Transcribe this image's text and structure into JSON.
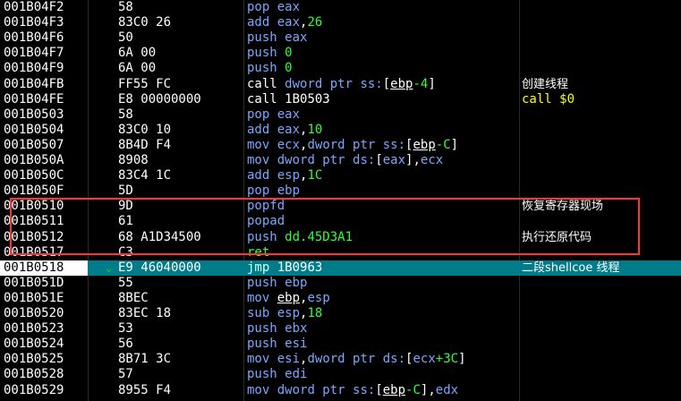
{
  "rows": [
    {
      "addr": "001B04F2",
      "bytes": "58",
      "code": [
        {
          "t": "pop",
          "c": "mn"
        },
        {
          "t": " ",
          "c": "txt"
        },
        {
          "t": "eax",
          "c": "reg"
        }
      ],
      "cmt": ""
    },
    {
      "addr": "001B04F3",
      "bytes": "83C0 26",
      "code": [
        {
          "t": "add",
          "c": "mn"
        },
        {
          "t": " ",
          "c": "txt"
        },
        {
          "t": "eax",
          "c": "reg"
        },
        {
          "t": ",",
          "c": "txt"
        },
        {
          "t": "26",
          "c": "num"
        }
      ],
      "cmt": ""
    },
    {
      "addr": "001B04F6",
      "bytes": "50",
      "code": [
        {
          "t": "push",
          "c": "mn"
        },
        {
          "t": " ",
          "c": "txt"
        },
        {
          "t": "eax",
          "c": "reg"
        }
      ],
      "cmt": ""
    },
    {
      "addr": "001B04F7",
      "bytes": "6A 00",
      "code": [
        {
          "t": "push",
          "c": "mn"
        },
        {
          "t": " ",
          "c": "txt"
        },
        {
          "t": "0",
          "c": "num"
        }
      ],
      "cmt": ""
    },
    {
      "addr": "001B04F9",
      "bytes": "6A 00",
      "code": [
        {
          "t": "push",
          "c": "mn"
        },
        {
          "t": " ",
          "c": "txt"
        },
        {
          "t": "0",
          "c": "num"
        }
      ],
      "cmt": ""
    },
    {
      "addr": "001B04FB",
      "bytes": "FF55 FC",
      "code": [
        {
          "t": "call",
          "c": "txt"
        },
        {
          "t": " ",
          "c": "txt"
        },
        {
          "t": "dword ptr ss:",
          "c": "kw"
        },
        {
          "t": "[",
          "c": "txt"
        },
        {
          "t": "ebp",
          "c": "ul"
        },
        {
          "t": "-4",
          "c": "num"
        },
        {
          "t": "]",
          "c": "txt"
        }
      ],
      "cmt": "创建线程"
    },
    {
      "addr": "001B04FE",
      "bytes": "E8 00000000",
      "code": [
        {
          "t": "call",
          "c": "txt"
        },
        {
          "t": " ",
          "c": "txt"
        },
        {
          "t": "1B0503",
          "c": "txt"
        }
      ],
      "cmt": "call $0",
      "cmt_style": "y"
    },
    {
      "addr": "001B0503",
      "bytes": "58",
      "code": [
        {
          "t": "pop",
          "c": "mn"
        },
        {
          "t": " ",
          "c": "txt"
        },
        {
          "t": "eax",
          "c": "reg"
        }
      ],
      "cmt": ""
    },
    {
      "addr": "001B0504",
      "bytes": "83C0 10",
      "code": [
        {
          "t": "add",
          "c": "mn"
        },
        {
          "t": " ",
          "c": "txt"
        },
        {
          "t": "eax",
          "c": "reg"
        },
        {
          "t": ",",
          "c": "txt"
        },
        {
          "t": "10",
          "c": "num"
        }
      ],
      "cmt": ""
    },
    {
      "addr": "001B0507",
      "bytes": "8B4D F4",
      "code": [
        {
          "t": "mov",
          "c": "mn"
        },
        {
          "t": " ",
          "c": "txt"
        },
        {
          "t": "ecx",
          "c": "reg"
        },
        {
          "t": ",",
          "c": "txt"
        },
        {
          "t": "dword ptr ss:",
          "c": "kw"
        },
        {
          "t": "[",
          "c": "txt"
        },
        {
          "t": "ebp",
          "c": "ul"
        },
        {
          "t": "-C",
          "c": "num"
        },
        {
          "t": "]",
          "c": "txt"
        }
      ],
      "cmt": ""
    },
    {
      "addr": "001B050A",
      "bytes": "8908",
      "code": [
        {
          "t": "mov",
          "c": "mn"
        },
        {
          "t": " ",
          "c": "txt"
        },
        {
          "t": "dword ptr ds:",
          "c": "kw"
        },
        {
          "t": "[",
          "c": "txt"
        },
        {
          "t": "eax",
          "c": "reg"
        },
        {
          "t": "]",
          "c": "txt"
        },
        {
          "t": ",",
          "c": "txt"
        },
        {
          "t": "ecx",
          "c": "reg"
        }
      ],
      "cmt": ""
    },
    {
      "addr": "001B050C",
      "bytes": "83C4 1C",
      "code": [
        {
          "t": "add",
          "c": "mn"
        },
        {
          "t": " ",
          "c": "txt"
        },
        {
          "t": "esp",
          "c": "reg"
        },
        {
          "t": ",",
          "c": "txt"
        },
        {
          "t": "1C",
          "c": "num"
        }
      ],
      "cmt": ""
    },
    {
      "addr": "001B050F",
      "bytes": "5D",
      "code": [
        {
          "t": "pop",
          "c": "mn"
        },
        {
          "t": " ",
          "c": "txt"
        },
        {
          "t": "ebp",
          "c": "reg"
        }
      ],
      "cmt": ""
    },
    {
      "addr": "001B0510",
      "bytes": "9D",
      "code": [
        {
          "t": "popfd",
          "c": "mn"
        }
      ],
      "cmt": "恢复寄存器现场"
    },
    {
      "addr": "001B0511",
      "bytes": "61",
      "code": [
        {
          "t": "popad",
          "c": "mn"
        }
      ],
      "cmt": ""
    },
    {
      "addr": "001B0512",
      "bytes": "68 A1D34500",
      "code": [
        {
          "t": "push",
          "c": "mn"
        },
        {
          "t": " ",
          "c": "txt"
        },
        {
          "t": "dd.45D3A1",
          "c": "num"
        }
      ],
      "cmt": "执行还原代码"
    },
    {
      "addr": "001B0517",
      "bytes": "C3",
      "code": [
        {
          "t": "ret",
          "c": "num"
        }
      ],
      "cmt": ""
    },
    {
      "addr": "001B0518",
      "bytes": "E9 46040000",
      "code": [
        {
          "t": "jmp",
          "c": "mn"
        },
        {
          "t": " ",
          "c": "txt"
        },
        {
          "t": "1B0963",
          "c": "txt"
        }
      ],
      "cmt": "二段shellcoe 线程",
      "selected": true,
      "arrow": "⌄"
    },
    {
      "addr": "001B051D",
      "bytes": "55",
      "code": [
        {
          "t": "push",
          "c": "mn"
        },
        {
          "t": " ",
          "c": "txt"
        },
        {
          "t": "ebp",
          "c": "reg"
        }
      ],
      "cmt": ""
    },
    {
      "addr": "001B051E",
      "bytes": "8BEC",
      "code": [
        {
          "t": "mov",
          "c": "mn"
        },
        {
          "t": " ",
          "c": "txt"
        },
        {
          "t": "ebp",
          "c": "ul"
        },
        {
          "t": ",",
          "c": "txt"
        },
        {
          "t": "esp",
          "c": "reg"
        }
      ],
      "cmt": ""
    },
    {
      "addr": "001B0520",
      "bytes": "83EC 18",
      "code": [
        {
          "t": "sub",
          "c": "mn"
        },
        {
          "t": " ",
          "c": "txt"
        },
        {
          "t": "esp",
          "c": "reg"
        },
        {
          "t": ",",
          "c": "txt"
        },
        {
          "t": "18",
          "c": "num"
        }
      ],
      "cmt": ""
    },
    {
      "addr": "001B0523",
      "bytes": "53",
      "code": [
        {
          "t": "push",
          "c": "mn"
        },
        {
          "t": " ",
          "c": "txt"
        },
        {
          "t": "ebx",
          "c": "reg"
        }
      ],
      "cmt": ""
    },
    {
      "addr": "001B0524",
      "bytes": "56",
      "code": [
        {
          "t": "push",
          "c": "mn"
        },
        {
          "t": " ",
          "c": "txt"
        },
        {
          "t": "esi",
          "c": "reg"
        }
      ],
      "cmt": ""
    },
    {
      "addr": "001B0525",
      "bytes": "8B71 3C",
      "code": [
        {
          "t": "mov",
          "c": "mn"
        },
        {
          "t": " ",
          "c": "txt"
        },
        {
          "t": "esi",
          "c": "reg"
        },
        {
          "t": ",",
          "c": "txt"
        },
        {
          "t": "dword ptr ds:",
          "c": "kw"
        },
        {
          "t": "[",
          "c": "txt"
        },
        {
          "t": "ecx",
          "c": "reg"
        },
        {
          "t": "+3C",
          "c": "num"
        },
        {
          "t": "]",
          "c": "txt"
        }
      ],
      "cmt": ""
    },
    {
      "addr": "001B0528",
      "bytes": "57",
      "code": [
        {
          "t": "push",
          "c": "mn"
        },
        {
          "t": " ",
          "c": "txt"
        },
        {
          "t": "edi",
          "c": "reg"
        }
      ],
      "cmt": ""
    },
    {
      "addr": "001B0529",
      "bytes": "8955 F4",
      "code": [
        {
          "t": "mov",
          "c": "mn"
        },
        {
          "t": " ",
          "c": "txt"
        },
        {
          "t": "dword ptr ss:",
          "c": "kw"
        },
        {
          "t": "[",
          "c": "txt"
        },
        {
          "t": "ebp",
          "c": "ul"
        },
        {
          "t": "-C",
          "c": "num"
        },
        {
          "t": "]",
          "c": "txt"
        },
        {
          "t": ",",
          "c": "txt"
        },
        {
          "t": "edx",
          "c": "reg"
        }
      ],
      "cmt": ""
    }
  ],
  "colors": {
    "background": "#000000",
    "selection": "#007b8a",
    "highlight_box": "#ff3333",
    "number": "#33ff33",
    "mnemonic": "#7aa7ff",
    "comment_accent": "#ffff00"
  }
}
